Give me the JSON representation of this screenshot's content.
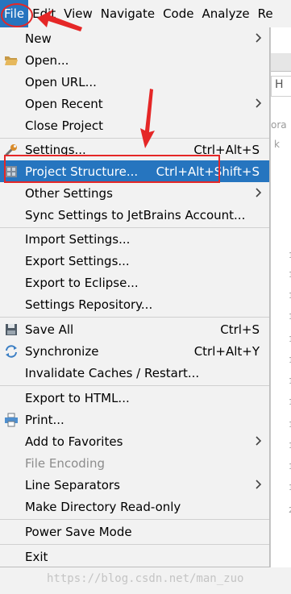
{
  "menubar": {
    "items": [
      "File",
      "Edit",
      "View",
      "Navigate",
      "Code",
      "Analyze",
      "Re"
    ]
  },
  "background": {
    "tab_text": "H",
    "side_letters": [
      "ora",
      "k"
    ],
    "gutter_marks": [
      "1",
      "1",
      "1",
      "1",
      "1",
      "1",
      "1",
      "1",
      "1",
      "1",
      "1",
      "1",
      "2"
    ]
  },
  "menu": {
    "items": [
      {
        "label": "New",
        "shortcut": "",
        "submenu": true
      },
      {
        "label": "Open...",
        "shortcut": "",
        "icon": "folder-open-icon"
      },
      {
        "label": "Open URL...",
        "shortcut": ""
      },
      {
        "label": "Open Recent",
        "shortcut": "",
        "submenu": true
      },
      {
        "label": "Close Project",
        "shortcut": ""
      },
      {
        "label": "Settings...",
        "shortcut": "Ctrl+Alt+S",
        "icon": "wrench-icon"
      },
      {
        "label": "Project Structure...",
        "shortcut": "Ctrl+Alt+Shift+S",
        "icon": "project-structure-icon",
        "selected": true
      },
      {
        "label": "Other Settings",
        "shortcut": "",
        "submenu": true
      },
      {
        "label": "Sync Settings to JetBrains Account...",
        "shortcut": ""
      },
      {
        "label": "Import Settings...",
        "shortcut": ""
      },
      {
        "label": "Export Settings...",
        "shortcut": ""
      },
      {
        "label": "Export to Eclipse...",
        "shortcut": ""
      },
      {
        "label": "Settings Repository...",
        "shortcut": ""
      },
      {
        "label": "Save All",
        "shortcut": "Ctrl+S",
        "icon": "save-icon"
      },
      {
        "label": "Synchronize",
        "shortcut": "Ctrl+Alt+Y",
        "icon": "sync-icon"
      },
      {
        "label": "Invalidate Caches / Restart...",
        "shortcut": ""
      },
      {
        "label": "Export to HTML...",
        "shortcut": ""
      },
      {
        "label": "Print...",
        "shortcut": "",
        "icon": "print-icon"
      },
      {
        "label": "Add to Favorites",
        "shortcut": "",
        "submenu": true
      },
      {
        "label": "File Encoding",
        "shortcut": "",
        "disabled": true
      },
      {
        "label": "Line Separators",
        "shortcut": "",
        "submenu": true
      },
      {
        "label": "Make Directory Read-only",
        "shortcut": ""
      },
      {
        "label": "Power Save Mode",
        "shortcut": ""
      },
      {
        "label": "Exit",
        "shortcut": ""
      }
    ]
  },
  "watermark": "https://blog.csdn.net/man_zuo",
  "colors": {
    "highlight": "#2675bf",
    "annotation_red": "#e52727",
    "menu_bg": "#f2f2f2"
  }
}
